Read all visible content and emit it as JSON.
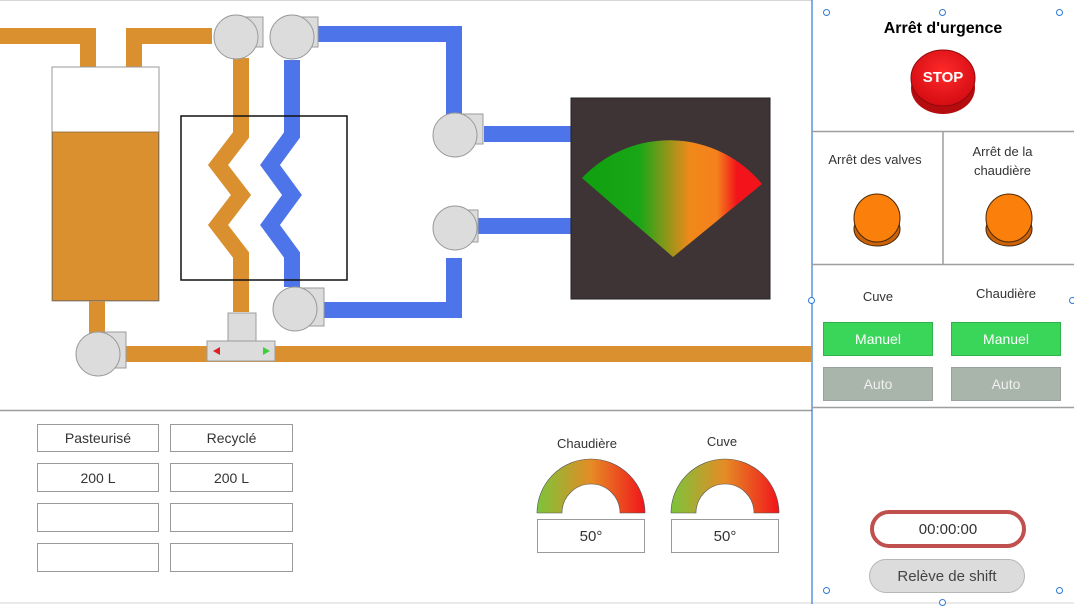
{
  "emergency": {
    "title": "Arrêt d'urgence",
    "stop_label": "STOP"
  },
  "stops": {
    "valves_label": "Arrêt des valves",
    "boiler_label": "Arrêt de la chaudière"
  },
  "modes": {
    "tank_label": "Cuve",
    "boiler_label": "Chaudière",
    "tank_manual": "Manuel",
    "tank_auto": "Auto",
    "boiler_manual": "Manuel",
    "boiler_auto": "Auto"
  },
  "volumes": {
    "headers": [
      "Pasteurisé",
      "Recyclé"
    ],
    "values": [
      "200 L",
      "200 L"
    ]
  },
  "gauges": [
    {
      "label": "Chaudière",
      "value": "50°"
    },
    {
      "label": "Cuve",
      "value": "50°"
    }
  ],
  "timer": {
    "value": "00:00:00"
  },
  "shift": {
    "label": "Relève de shift"
  },
  "colors": {
    "hot_pipe": "#db9030",
    "cold_pipe": "#4d74e8",
    "stop_red": "#e8141e",
    "stop_orange": "#fa7f0b",
    "manual_green": "#3ad65a",
    "auto_gray": "#a9b5ab",
    "monitor_bg": "#3e3435",
    "timer_border": "#c0504d"
  }
}
